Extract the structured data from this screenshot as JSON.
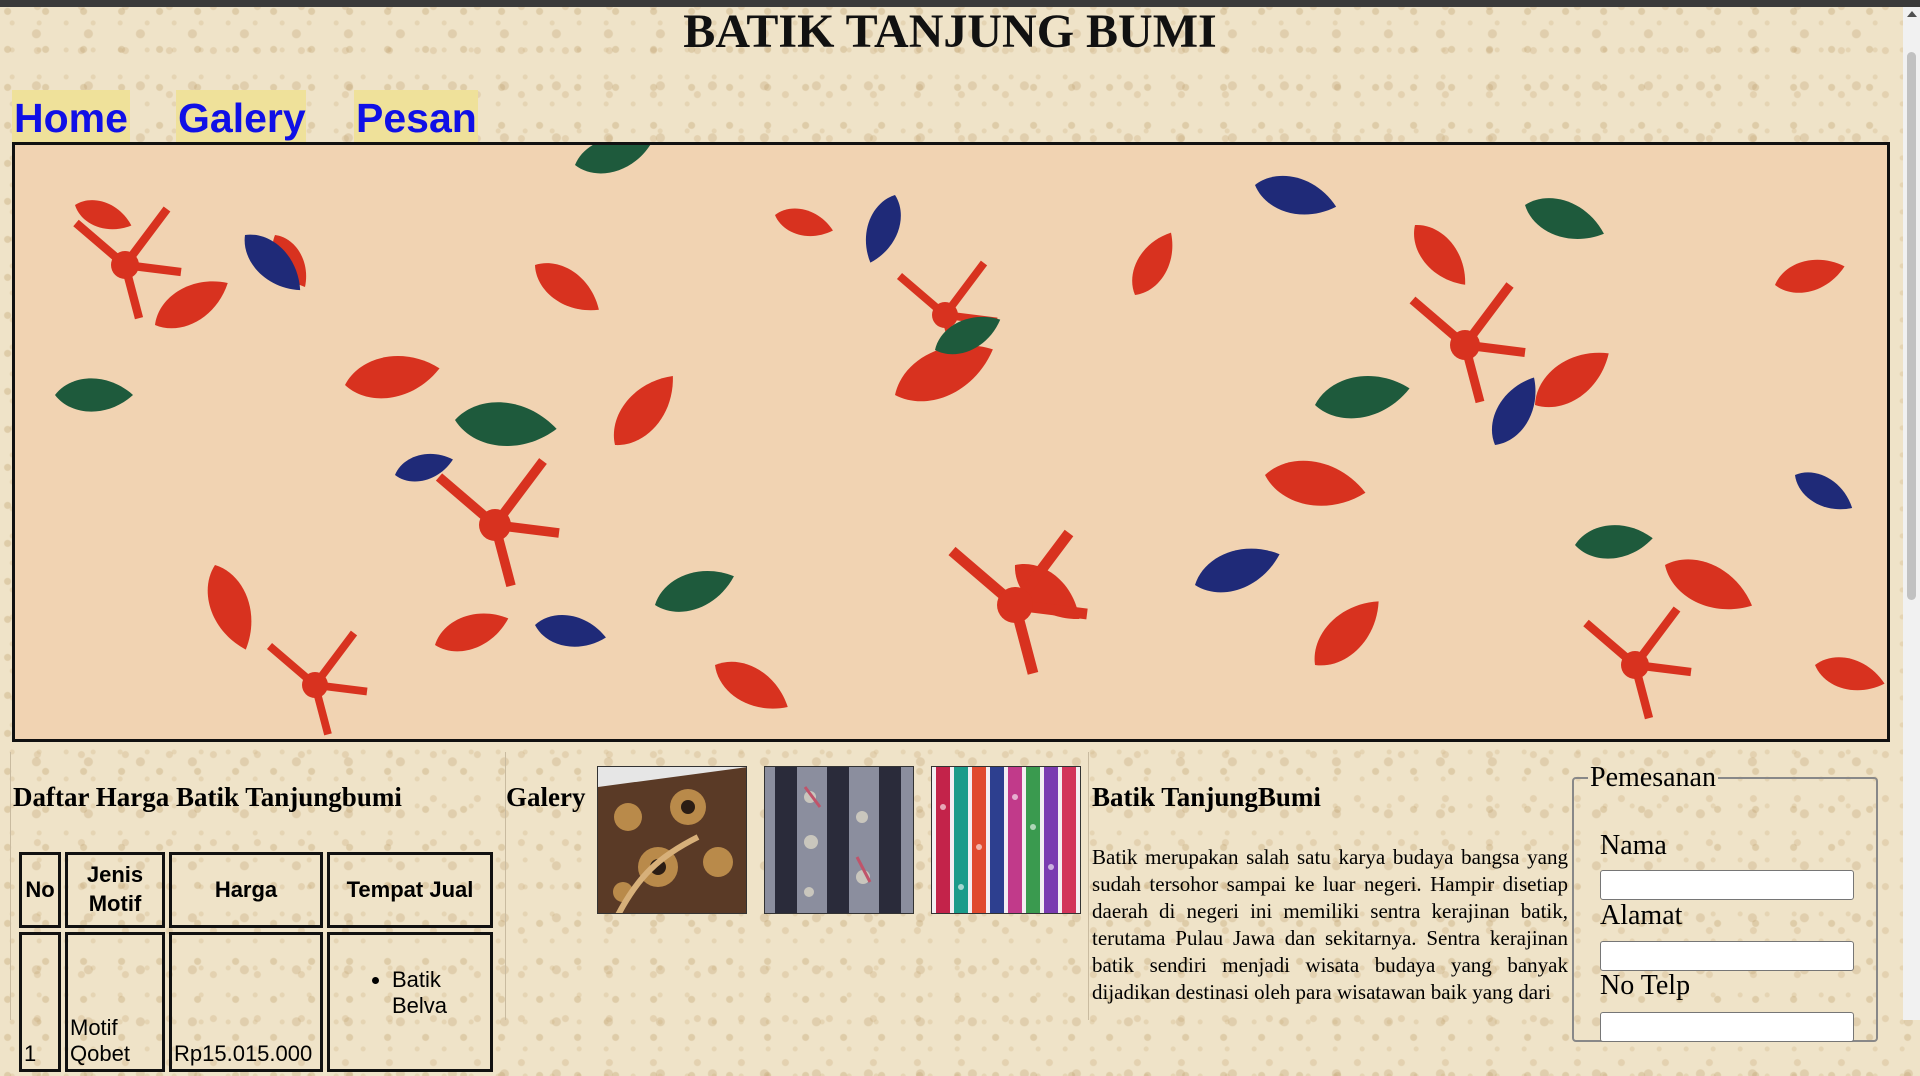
{
  "header": {
    "title": "BATIK TANJUNG BUMI"
  },
  "nav": {
    "items": [
      {
        "label": "Home"
      },
      {
        "label": "Galery"
      },
      {
        "label": "Pesan"
      }
    ]
  },
  "price_list": {
    "heading": "Daftar Harga Batik Tanjungbumi",
    "columns": [
      "No",
      "Jenis Motif",
      "Harga",
      "Tempat Jual"
    ],
    "rows": [
      {
        "no": "1",
        "motif": "Motif Qobet",
        "harga": "Rp15.015.000",
        "tempat": [
          "Batik Belva"
        ]
      }
    ]
  },
  "gallery": {
    "label": "Galery",
    "thumbnails": [
      "batik-cloth-brown",
      "batik-cloth-grey",
      "batik-cloth-striped"
    ]
  },
  "article": {
    "heading": "Batik TanjungBumi",
    "body": "Batik merupakan salah satu karya budaya bangsa yang sudah tersohor sampai ke luar negeri. Hampir disetiap daerah di negeri ini memiliki sentra kerajinan batik, terutama Pulau Jawa dan sekitarnya. Sentra kerajinan batik sendiri menjadi wisata budaya yang banyak dijadikan destinasi oleh para wisatawan baik yang dari"
  },
  "order_form": {
    "legend": "Pemesanan",
    "fields": [
      {
        "label": "Nama",
        "value": "",
        "placeholder": ""
      },
      {
        "label": "Alamat",
        "value": "",
        "placeholder": ""
      },
      {
        "label": "No Telp",
        "value": "",
        "placeholder": ""
      }
    ]
  },
  "colors": {
    "nav_link": "#1010e6",
    "nav_highlight": "#efe19a",
    "page_bg": "#efe3c8",
    "batik_red": "#d8321f",
    "batik_blue": "#1f2a78",
    "batik_green": "#1e5a3c"
  }
}
